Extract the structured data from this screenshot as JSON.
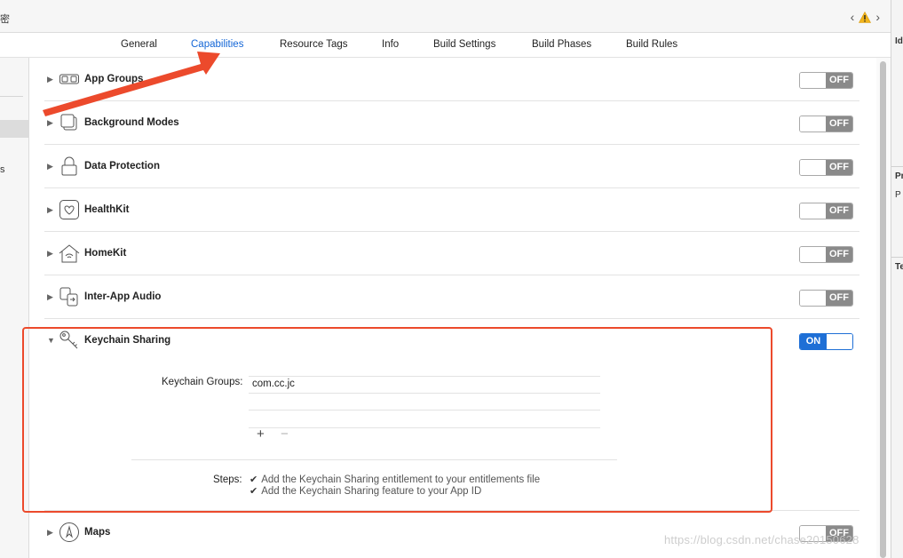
{
  "header": {
    "title_fragment": "密",
    "nav_back": "‹",
    "nav_forward": "›"
  },
  "tabs": [
    {
      "label": "General",
      "active": false
    },
    {
      "label": "Capabilities",
      "active": true
    },
    {
      "label": "Resource Tags",
      "active": false
    },
    {
      "label": "Info",
      "active": false
    },
    {
      "label": "Build Settings",
      "active": false
    },
    {
      "label": "Build Phases",
      "active": false
    },
    {
      "label": "Build Rules",
      "active": false
    }
  ],
  "sidebar": {
    "fragment": "s"
  },
  "inspector": {
    "labels": [
      "Id",
      "Pr",
      "P",
      "Te"
    ]
  },
  "capabilities": [
    {
      "name": "App Groups",
      "icon": "app-groups-icon",
      "state": "OFF"
    },
    {
      "name": "Background Modes",
      "icon": "background-modes-icon",
      "state": "OFF"
    },
    {
      "name": "Data Protection",
      "icon": "lock-icon",
      "state": "OFF"
    },
    {
      "name": "HealthKit",
      "icon": "heart-icon",
      "state": "OFF"
    },
    {
      "name": "HomeKit",
      "icon": "home-icon",
      "state": "OFF"
    },
    {
      "name": "Inter-App Audio",
      "icon": "inter-app-audio-icon",
      "state": "OFF"
    },
    {
      "name": "Keychain Sharing",
      "icon": "key-icon",
      "state": "ON"
    },
    {
      "name": "Maps",
      "icon": "compass-icon",
      "state": "OFF"
    }
  ],
  "keychain": {
    "groups_label": "Keychain Groups:",
    "groups": [
      "com.cc.jc"
    ],
    "add_symbol": "+",
    "remove_symbol": "−",
    "steps_label": "Steps:",
    "steps": [
      "Add the Keychain Sharing entitlement to your entitlements file",
      "Add the Keychain Sharing feature to your App ID"
    ],
    "check_symbol": "✔"
  },
  "watermark": "https://blog.csdn.net/chase20150628",
  "colors": {
    "accent": "#1e6fd6",
    "off": "#8a8a8a",
    "annotation": "#ec4a2c",
    "warning": "#f2b51b"
  }
}
